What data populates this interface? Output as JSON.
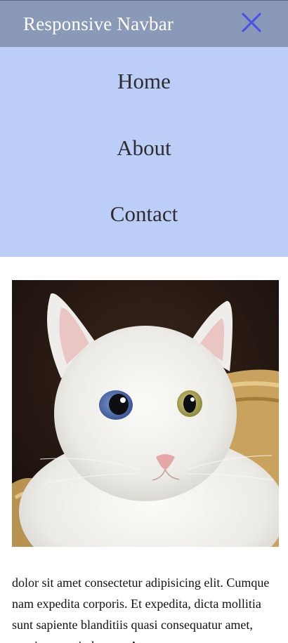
{
  "navbar": {
    "title": "Responsive Navbar",
    "close_icon": "close-icon",
    "background": "#8a99b7",
    "close_color": "#4b52e6"
  },
  "menu": {
    "background": "#bccdf8",
    "items": [
      {
        "label": "Home"
      },
      {
        "label": "About"
      },
      {
        "label": "Contact"
      }
    ]
  },
  "main": {
    "image_subject": "white cat with heterochromatic eyes in wicker basket",
    "paragraph": "dolor sit amet consectetur adipisicing elit. Cumque nam expedita corporis. Et expedita, dicta mollitia sunt sapiente blanditiis quasi consequatur amet, possimus optio harum. At"
  }
}
